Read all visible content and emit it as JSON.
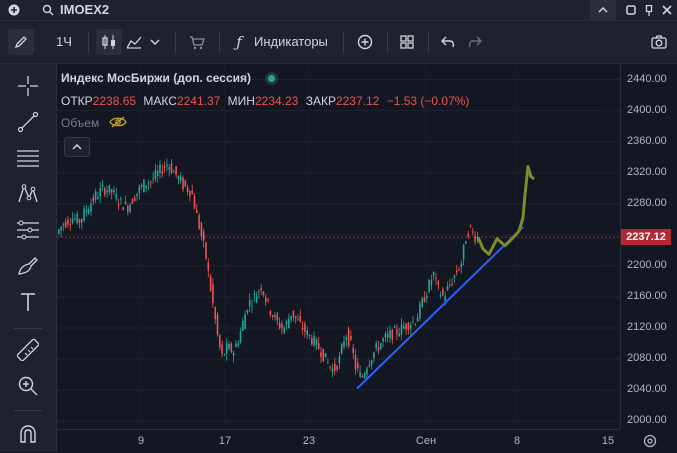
{
  "topbar": {
    "symbol": "IMOEX2"
  },
  "toolbar": {
    "interval": "1Ч",
    "indicators_label": "Индикаторы"
  },
  "legend": {
    "title": "Индекс МосБиржи (доп. сессия)",
    "open_label": "ОТКР",
    "open_value": "2238.65",
    "high_label": "МАКС",
    "high_value": "2241.37",
    "low_label": "МИН",
    "low_value": "2234.23",
    "close_label": "ЗАКР",
    "close_value": "2237.12",
    "change": "−1.53 (−0.07%)",
    "volume_label": "Объем"
  },
  "colors": {
    "up": "#26a69a",
    "down": "#ef5350",
    "trendline": "#2962ff",
    "projection": "#7b8c2a",
    "price_tag": "#b22833"
  },
  "chart_data": {
    "type": "candlestick",
    "x_ticks": [
      "9",
      "17",
      "23",
      "Сен",
      "8",
      "15"
    ],
    "y_ticks": [
      "2440.00",
      "2400.00",
      "2360.00",
      "2320.00",
      "2280.00",
      "2240.00",
      "2200.00",
      "2160.00",
      "2120.00",
      "2080.00",
      "2040.00",
      "2000.00"
    ],
    "ylim": [
      1990,
      2460
    ],
    "current_price": "2237.12",
    "series_path": [
      [
        0,
        2240
      ],
      [
        8,
        2255
      ],
      [
        16,
        2262
      ],
      [
        24,
        2258
      ],
      [
        32,
        2275
      ],
      [
        40,
        2290
      ],
      [
        48,
        2300
      ],
      [
        56,
        2296
      ],
      [
        64,
        2282
      ],
      [
        72,
        2276
      ],
      [
        80,
        2292
      ],
      [
        88,
        2305
      ],
      [
        96,
        2310
      ],
      [
        104,
        2322
      ],
      [
        112,
        2332
      ],
      [
        120,
        2318
      ],
      [
        128,
        2303
      ],
      [
        136,
        2296
      ],
      [
        140,
        2272
      ],
      [
        146,
        2238
      ],
      [
        150,
        2215
      ],
      [
        154,
        2180
      ],
      [
        158,
        2145
      ],
      [
        162,
        2110
      ],
      [
        166,
        2082
      ],
      [
        172,
        2095
      ],
      [
        178,
        2090
      ],
      [
        184,
        2110
      ],
      [
        192,
        2150
      ],
      [
        200,
        2162
      ],
      [
        206,
        2175
      ],
      [
        212,
        2150
      ],
      [
        220,
        2130
      ],
      [
        228,
        2118
      ],
      [
        236,
        2140
      ],
      [
        244,
        2125
      ],
      [
        252,
        2112
      ],
      [
        260,
        2100
      ],
      [
        266,
        2090
      ],
      [
        272,
        2075
      ],
      [
        278,
        2065
      ],
      [
        284,
        2080
      ],
      [
        290,
        2115
      ],
      [
        296,
        2095
      ],
      [
        300,
        2070
      ],
      [
        306,
        2055
      ],
      [
        312,
        2075
      ],
      [
        320,
        2092
      ],
      [
        328,
        2105
      ],
      [
        336,
        2112
      ],
      [
        344,
        2118
      ],
      [
        352,
        2125
      ],
      [
        360,
        2130
      ],
      [
        366,
        2150
      ],
      [
        372,
        2170
      ],
      [
        378,
        2190
      ],
      [
        382,
        2170
      ],
      [
        388,
        2160
      ],
      [
        394,
        2175
      ],
      [
        400,
        2190
      ],
      [
        406,
        2205
      ],
      [
        410,
        2235
      ],
      [
        414,
        2250
      ],
      [
        418,
        2240
      ],
      [
        421,
        2237
      ]
    ],
    "projection": [
      [
        421,
        2237
      ],
      [
        426,
        2222
      ],
      [
        432,
        2215
      ],
      [
        440,
        2235
      ],
      [
        448,
        2226
      ],
      [
        456,
        2236
      ],
      [
        462,
        2245
      ],
      [
        466,
        2262
      ],
      [
        468,
        2292
      ],
      [
        471,
        2328
      ],
      [
        474,
        2315
      ],
      [
        477,
        2312
      ]
    ],
    "trendline": [
      [
        300,
        2042
      ],
      [
        466,
        2250
      ]
    ]
  }
}
